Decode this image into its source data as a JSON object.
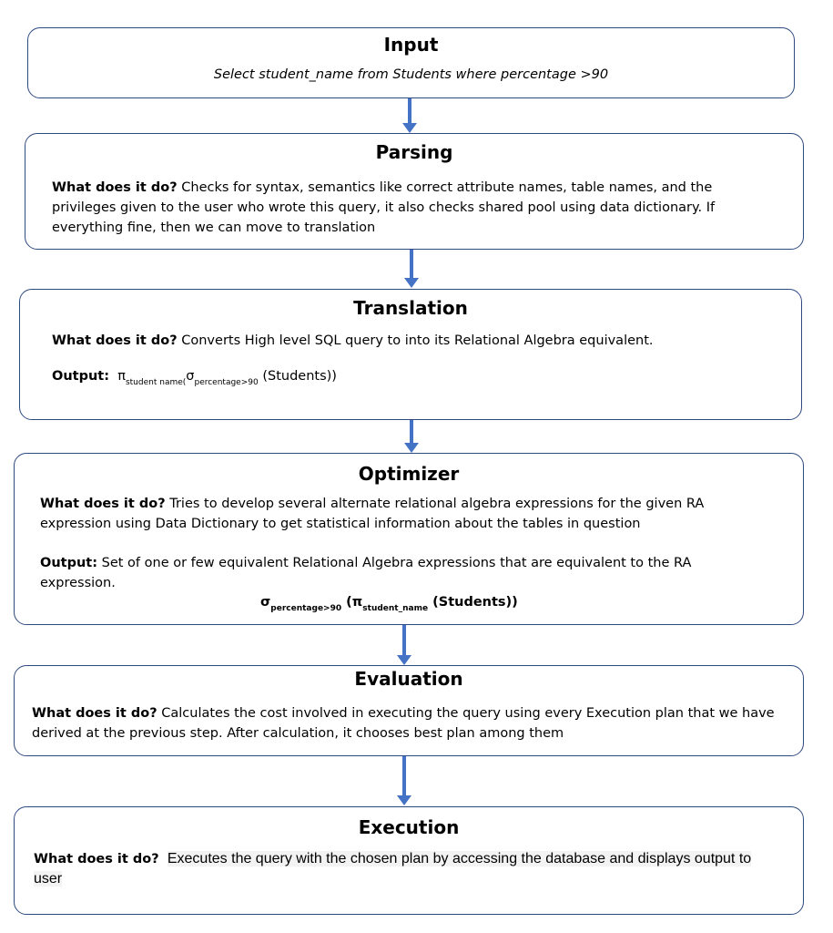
{
  "input": {
    "title": "Input",
    "query": "Select student_name from Students where percentage >90"
  },
  "parsing": {
    "title": "Parsing",
    "label": "What does it do?",
    "text": " Checks for syntax, semantics like correct attribute names, table names, and the privileges given to the user who wrote this query, it also checks shared pool using data dictionary. If everything fine, then we can move to translation"
  },
  "translation": {
    "title": "Translation",
    "label": "What does it do?",
    "text": "  Converts High level SQL query to into its Relational Algebra equivalent.",
    "output_label": "Output:",
    "pi": "π",
    "pi_sub": "student  name(",
    "sigma": "σ",
    "sigma_sub": "percentage>90",
    "tail": " (Students))"
  },
  "optimizer": {
    "title": "Optimizer",
    "label": "What does it do?",
    "text": "  Tries to develop several alternate relational algebra expressions for the given RA expression using Data Dictionary to get statistical information about the tables in question",
    "output_label": "Output:",
    "output_text": " Set of one or few equivalent Relational Algebra expressions that are equivalent to the RA expression.",
    "sigma": "σ",
    "sigma_sub": "percentage>90",
    "open": " (π",
    "pi_sub": "student_name",
    "tail": " (Students))"
  },
  "evaluation": {
    "title": "Evaluation",
    "label": "What does it do?",
    "text": " Calculates the cost involved in executing the query using every Execution plan that we have derived at the previous step. After calculation, it chooses best plan among them"
  },
  "execution": {
    "title": "Execution",
    "label": "What does it do?",
    "text": "Executes the query with the chosen plan by accessing the database and displays output to user"
  },
  "colors": {
    "border": "#2f4a80",
    "arrow": "#4472c4"
  }
}
